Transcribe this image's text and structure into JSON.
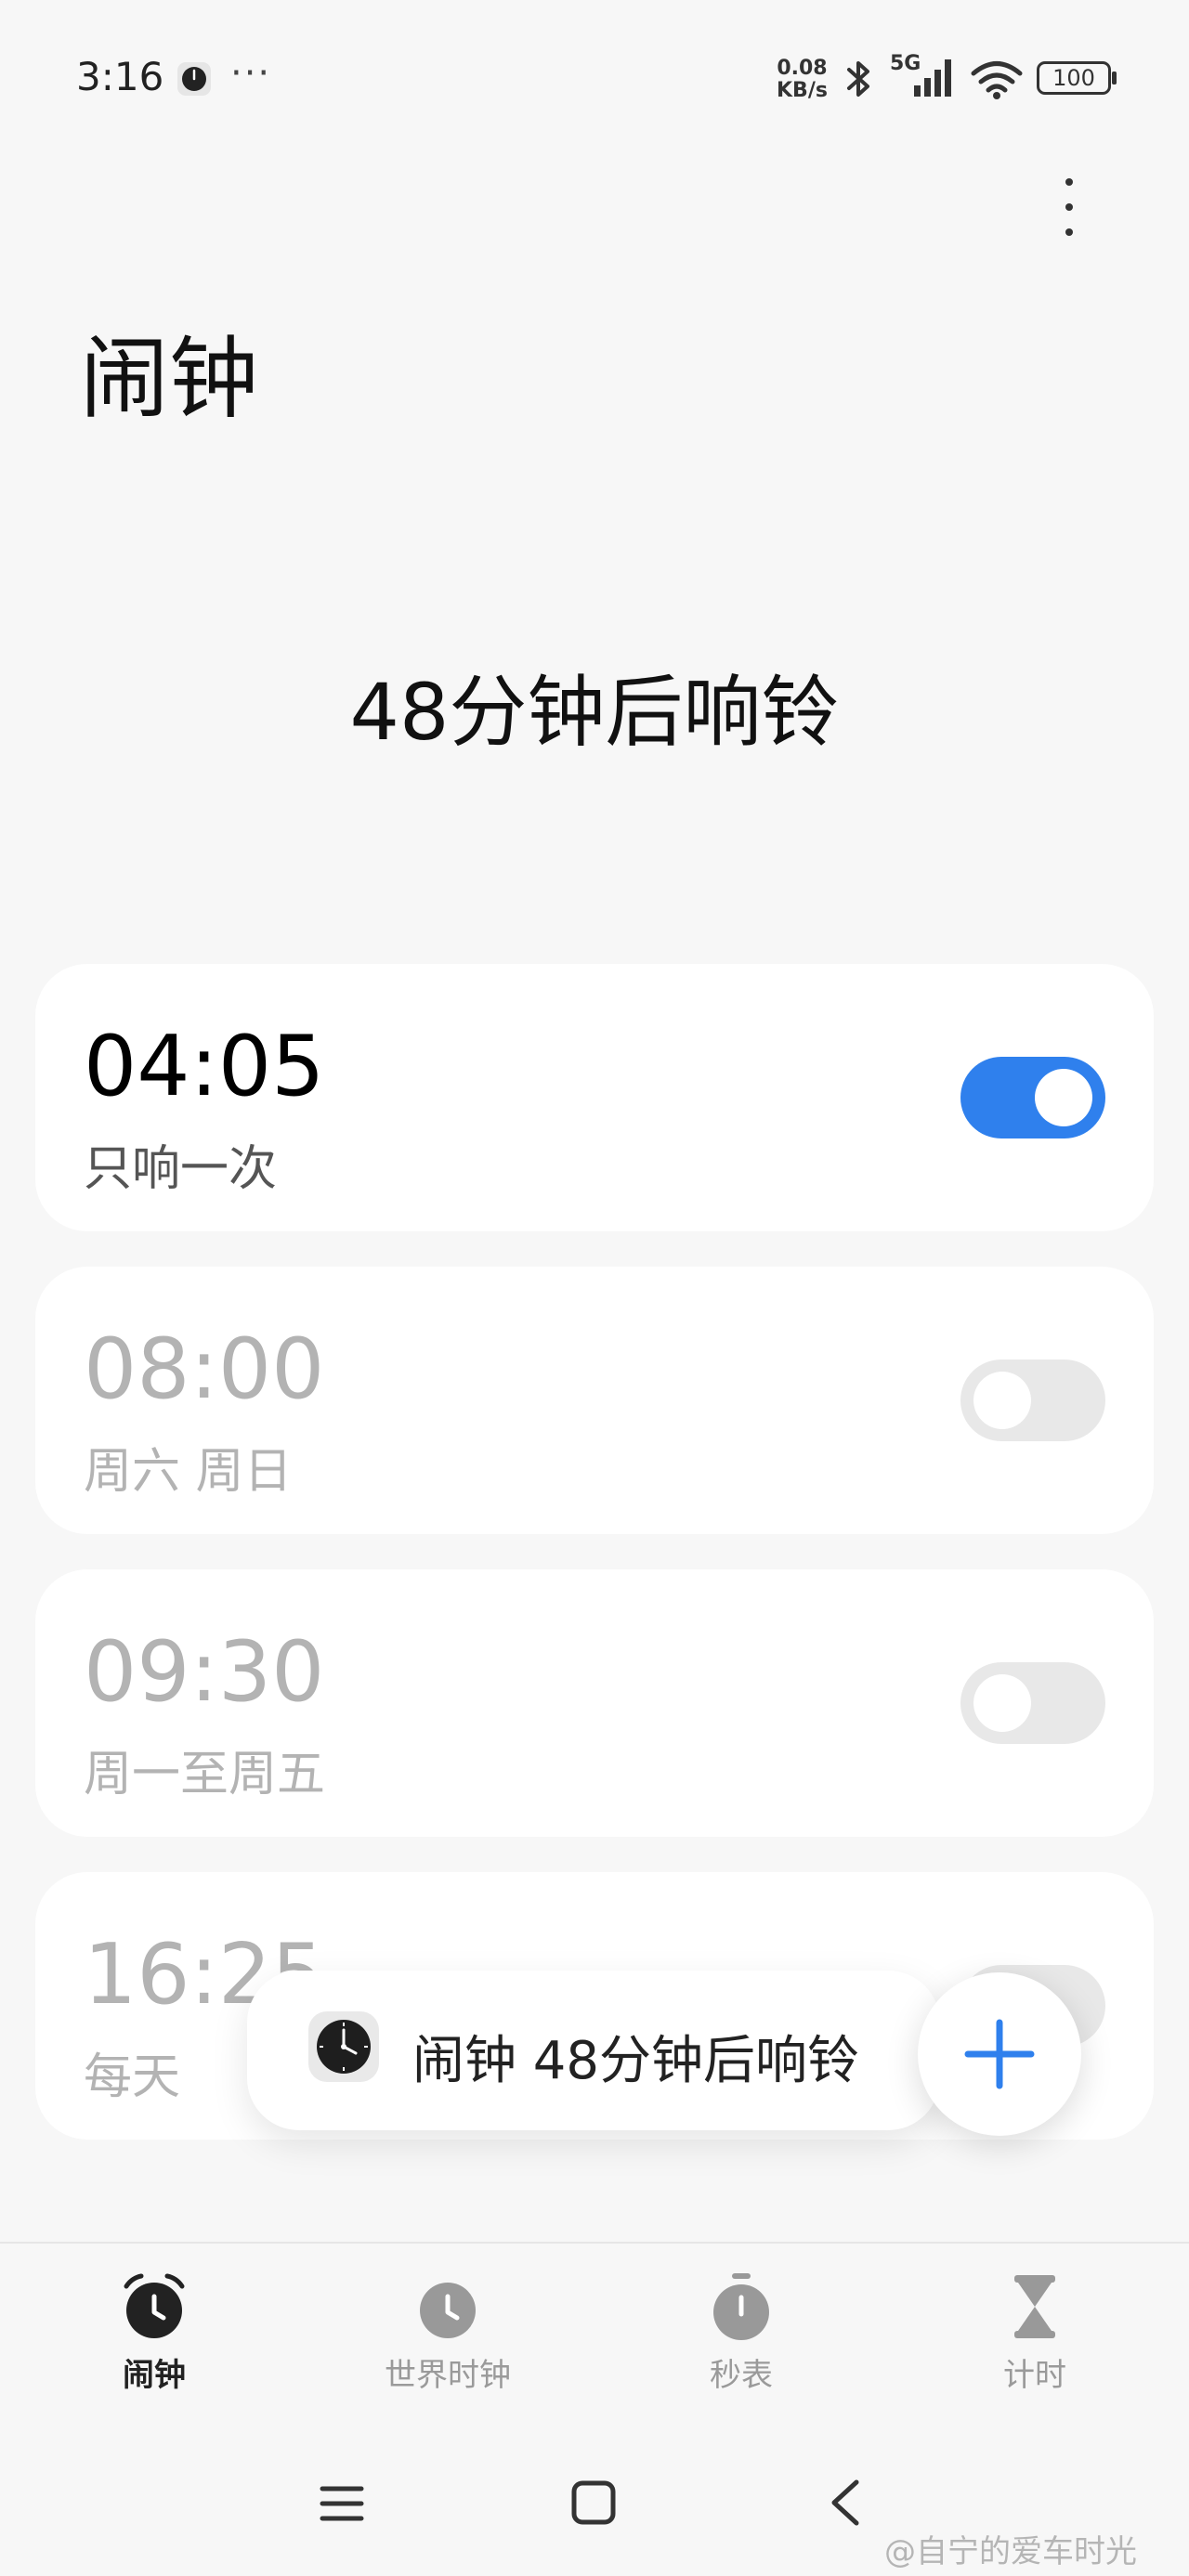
{
  "status_bar": {
    "time": "3:16",
    "more": "···",
    "net_speed_value": "0.08",
    "net_speed_unit": "KB/s",
    "network": "5G",
    "battery": "100"
  },
  "header": {
    "title": "闹钟"
  },
  "next_alarm": "48分钟后响铃",
  "alarms": [
    {
      "time": "04:05",
      "repeat": "只响一次",
      "enabled": true
    },
    {
      "time": "08:00",
      "repeat": "周六 周日",
      "enabled": false
    },
    {
      "time": "09:30",
      "repeat": "周一至周五",
      "enabled": false
    },
    {
      "time": "16:25",
      "repeat": "每天",
      "enabled": false
    }
  ],
  "toast": {
    "text": "闹钟 48分钟后响铃"
  },
  "nav": [
    {
      "label": "闹钟",
      "icon": "alarm-clock-icon",
      "active": true
    },
    {
      "label": "世界时钟",
      "icon": "world-clock-icon",
      "active": false
    },
    {
      "label": "秒表",
      "icon": "stopwatch-icon",
      "active": false
    },
    {
      "label": "计时",
      "icon": "hourglass-icon",
      "active": false
    }
  ],
  "watermark": "@自宁的爱车时光",
  "colors": {
    "accent": "#2f80ed",
    "toggle_off": "#e8e8e8",
    "disabled_text": "#b3b3b3",
    "background": "#f7f7f7"
  }
}
